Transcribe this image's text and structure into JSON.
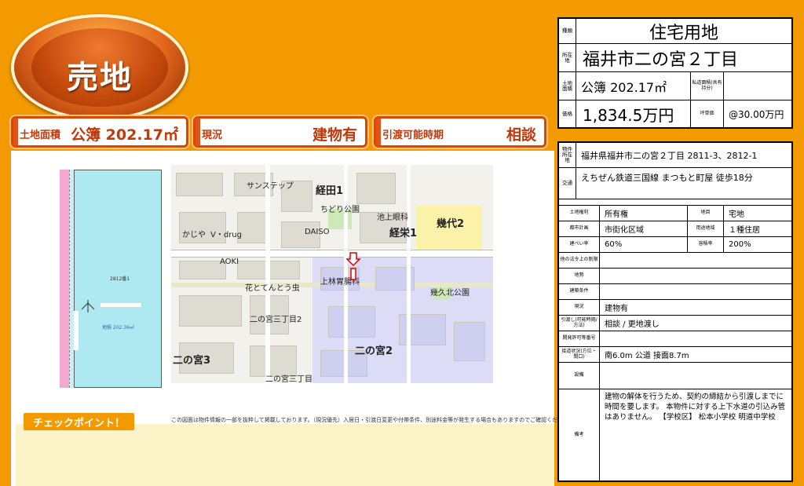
{
  "badge": "売地",
  "summary": [
    {
      "label": "土地面積",
      "value": "公簿 202.17㎡"
    },
    {
      "label": "現況",
      "value": "建物有"
    },
    {
      "label": "引渡可能時期",
      "value": "相談"
    }
  ],
  "top_table": {
    "type_label": "種類",
    "type_value": "住宅用地",
    "location_label": "所在地",
    "location_value": "福井市二の宮２丁目",
    "area_label": "土地面積",
    "area_value": "公簿 202.17㎡",
    "private_road_label": "私道面積(共有持分)",
    "private_road_value": "",
    "price_label": "価格",
    "price_value": "1,834.5万円",
    "tsubo_label": "坪単価",
    "tsubo_value": "@30.00万円"
  },
  "detail_table": {
    "address_label": "物件所在地",
    "address_value": "福井県福井市二の宮２丁目 2811-3、2812-1",
    "transport_label": "交通",
    "transport_value": "えちぜん鉄道三国線 まつもと町屋 徒歩18分",
    "rows": [
      {
        "l1": "土地権利",
        "v1": "所有権",
        "l2": "地目",
        "v2": "宅地"
      },
      {
        "l1": "都市計画",
        "v1": "市街化区域",
        "l2": "用途地域",
        "v2": "１種住居"
      },
      {
        "l1": "建ぺい率",
        "v1": "60%",
        "l2": "容積率",
        "v2": "200%"
      }
    ],
    "other_law_label": "他の法令上の制限",
    "other_law_value": "",
    "terrain_label": "地勢",
    "terrain_value": "",
    "building_cond_label": "建築条件",
    "building_cond_value": "",
    "status_label": "現況",
    "status_value": "建物有",
    "handover_label": "引渡し(可能時期/方法)",
    "handover_value": "相談 / 更地渡し",
    "dev_permit_label": "開発許可等番号",
    "dev_permit_value": "",
    "road_label": "接道状況(方位・間口)",
    "road_value": "南6.0m 公道 接面8.7m",
    "facility_label": "設備",
    "facility_value": "",
    "remarks_label": "備考",
    "remarks_value": "建物の解体を行うため、契約の締結から引渡しまでに時間を要します。 本物件に対する上下水道の引込み管はありません。 【学校区】 松本小学校 明道中学校"
  },
  "map": {
    "labels": [
      "サンステップ",
      "経田1",
      "ちどり公園",
      "池上眼科",
      "幾代2",
      "かじや",
      "V・drug",
      "DAISO",
      "経栄1",
      "AOKI",
      "上林胃腸科",
      "花とてんとう虫",
      "幾久北公園",
      "二の宮三丁目2",
      "二の宮2",
      "二の宮3",
      "二の宮三丁目"
    ]
  },
  "survey": {
    "lot": "2812番1",
    "area": "地積 202.36㎡"
  },
  "note": "この図面は物件情報の一部を抜粋して掲載しております。（現況優先）入居日・引渡日変更や付帯条件、別途料金等が発生する場合もありますのでご確認ください。",
  "checkpoint": "チェックポイント！",
  "colors": {
    "background": "#f39a00",
    "accent": "#e0541a",
    "check_area": "#fdf3c9"
  }
}
